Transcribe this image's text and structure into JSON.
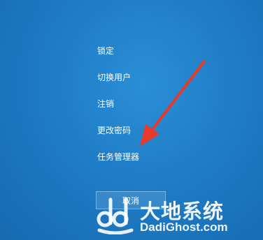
{
  "menu": {
    "items": [
      {
        "label": "锁定"
      },
      {
        "label": "切换用户"
      },
      {
        "label": "注销"
      },
      {
        "label": "更改密码"
      },
      {
        "label": "任务管理器"
      }
    ]
  },
  "cancel_label": "取消",
  "watermark": {
    "name": "大地系统",
    "url": "DadiGhost.com"
  },
  "colors": {
    "background": "#1f7cc6",
    "arrow": "#e83a2a",
    "text": "#ffffff"
  }
}
